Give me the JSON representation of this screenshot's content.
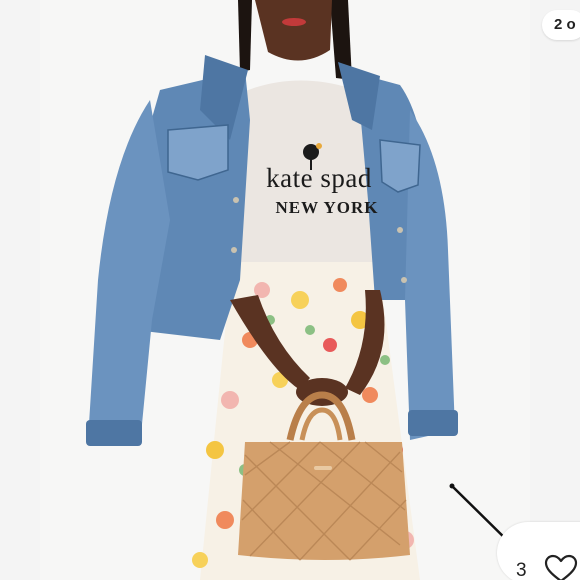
{
  "gallery": {
    "counter_text": "2 o",
    "like_count": "3"
  },
  "photo": {
    "shirt_line1": "kate spad",
    "shirt_line2": "NEW YORK"
  },
  "icons": {
    "like": "heart-outline-icon"
  },
  "colors": {
    "denim": "#5f88b5",
    "denim_dark": "#3f6690",
    "tee": "#ebe6e1",
    "skirt": "#f7f1e6",
    "bag": "#d4a06c",
    "skin": "#5a3322"
  }
}
